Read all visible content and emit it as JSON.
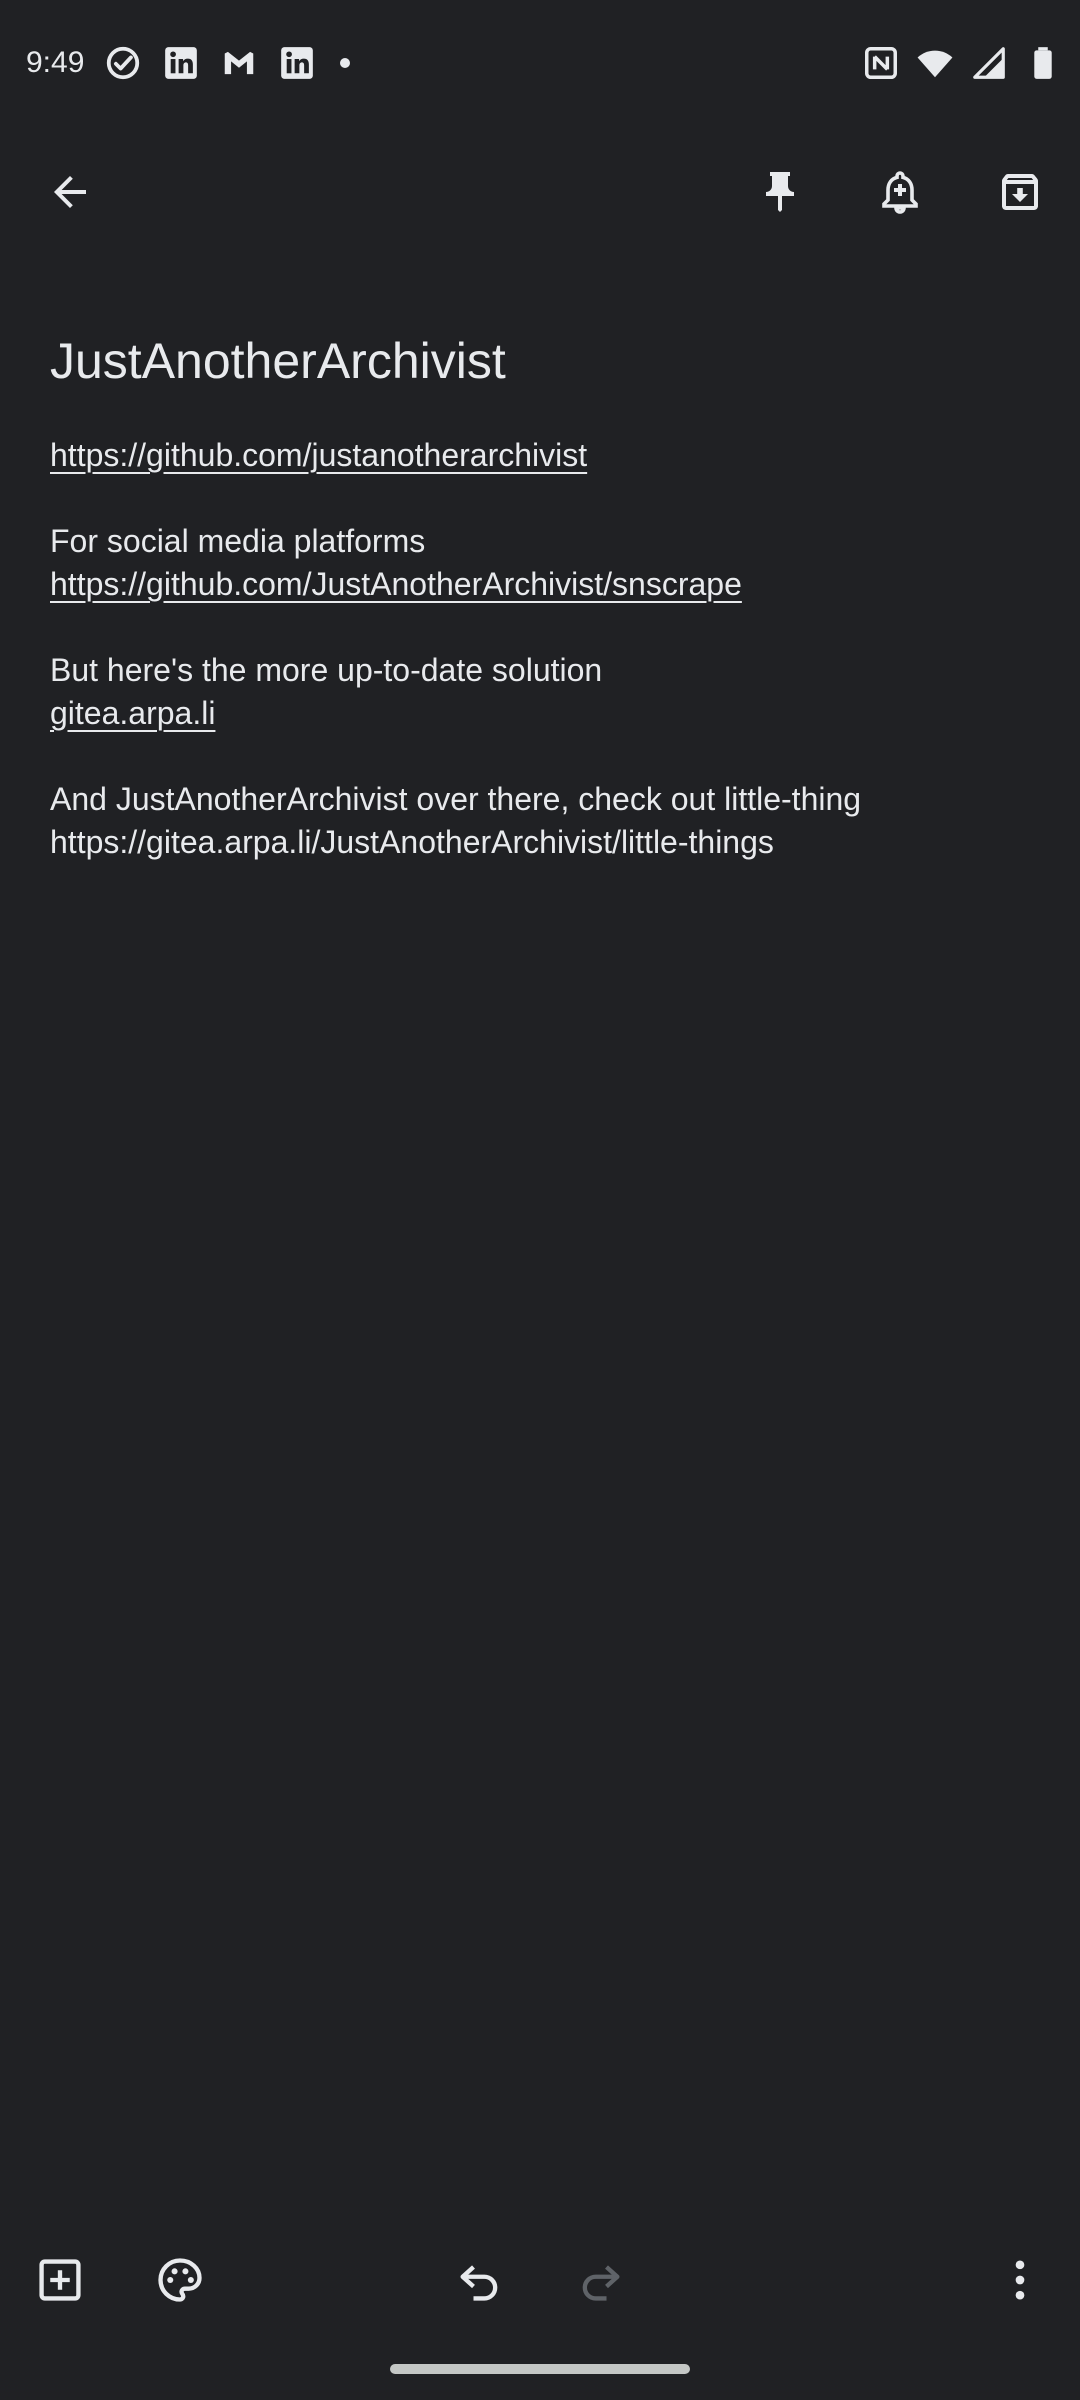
{
  "status_bar": {
    "time": "9:49",
    "left_icons": [
      "check-circle-icon",
      "linkedin-icon",
      "gmail-icon",
      "linkedin-icon",
      "dot-icon"
    ],
    "right_icons": [
      "nfc-icon",
      "wifi-icon",
      "signal-icon",
      "battery-icon"
    ]
  },
  "toolbar": {
    "back_icon": "arrow-back-icon",
    "pin_icon": "pin-icon",
    "reminder_icon": "add-alert-icon",
    "archive_icon": "archive-icon"
  },
  "note": {
    "title": "JustAnotherArchivist",
    "paragraphs": [
      {
        "lines": [
          {
            "text": "https://github.com/justanotherarchivist",
            "link": true
          }
        ]
      },
      {
        "lines": [
          {
            "text": "For social media platforms",
            "link": false
          },
          {
            "text": "https://github.com/JustAnotherArchivist/snscrape",
            "link": true
          }
        ]
      },
      {
        "lines": [
          {
            "text": "But here's the more up-to-date solution",
            "link": false
          },
          {
            "text": "gitea.arpa.li",
            "link": true
          }
        ]
      },
      {
        "lines": [
          {
            "text": "And JustAnotherArchivist over there, check out little-thing",
            "link": false
          },
          {
            "text": "https://gitea.arpa.li/JustAnotherArchivist/little-things",
            "link": false
          }
        ]
      }
    ]
  },
  "bottom_bar": {
    "icons": [
      "add-box-icon",
      "palette-icon",
      "undo-icon",
      "redo-icon",
      "more-vert-icon"
    ],
    "redo_enabled": false
  },
  "colors": {
    "background": "#202124",
    "text": "#e8eaed",
    "icon": "#e8eaed",
    "disabled_icon": "#5f6368"
  }
}
